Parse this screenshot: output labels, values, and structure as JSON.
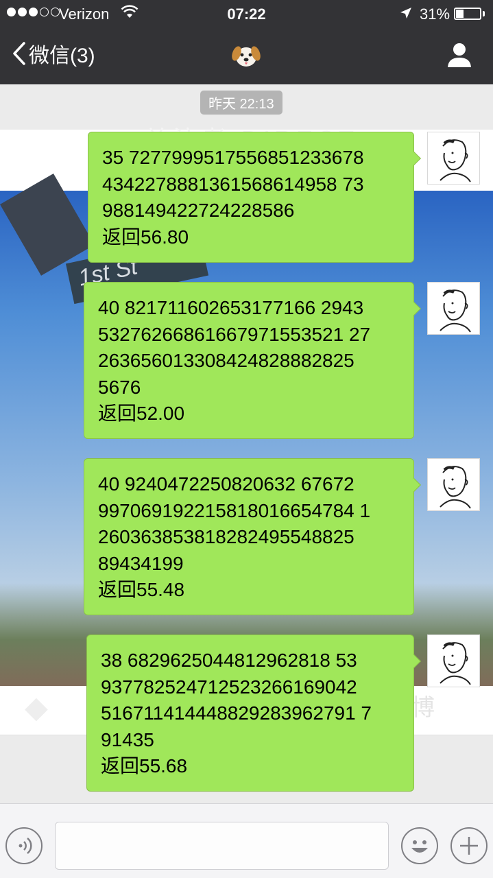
{
  "status_bar": {
    "carrier": "Verizon",
    "time": "07:22",
    "battery": "31%",
    "battery_level": 0.31
  },
  "nav": {
    "back_label": "微信(3)",
    "title_icon": "dog-face-emoji",
    "right_icon": "profile-icon"
  },
  "chat": {
    "timestamp": "昨天 22:13",
    "background_faded_text": "关注者 DIRECT",
    "messages": [
      {
        "text": "35 7277999517556851233678\n4342278881361568614958 73\n988149422724228586\n返回56.80"
      },
      {
        "text": "40 821711602653177166 2943\n53276266861667971553521 27\n263656013308424828882825\n5676\n返回52.00"
      },
      {
        "text": "40 9240472250820632 67672\n997069192215818016654784 1\n260363853818282495548825\n89434199\n返回55.48"
      },
      {
        "text": "38 6829625044812962818 53\n937782524712523266169042\n516711414448829283962791 7\n91435\n返回55.68"
      }
    ]
  },
  "input": {
    "placeholder": ""
  },
  "colors": {
    "bubble": "#a0e75a",
    "topbar": "#333336"
  }
}
